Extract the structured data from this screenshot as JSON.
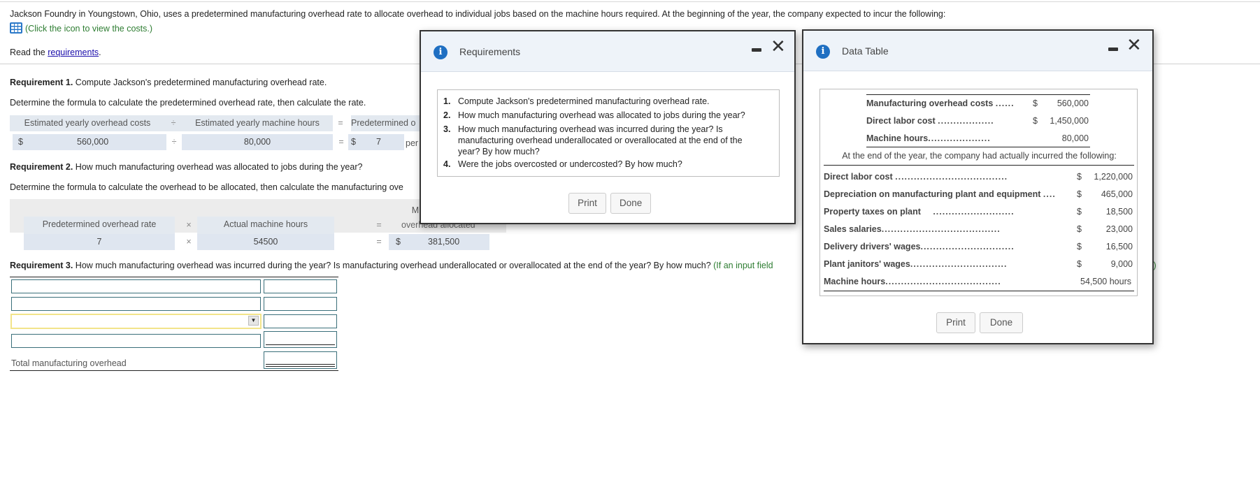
{
  "problem": {
    "intro": "Jackson Foundry in Youngstown, Ohio, uses a predetermined manufacturing overhead rate to allocate overhead to individual jobs based on the machine hours required. At the beginning of the year, the company expected to incur the following:",
    "click_icon_text": "(Click the icon to view the costs.)",
    "read_prefix": "Read the ",
    "requirements_link": "requirements",
    "read_suffix": "."
  },
  "req1": {
    "label": "Requirement 1.",
    "text": " Compute Jackson's predetermined manufacturing overhead rate.",
    "instruction": "Determine the formula to calculate the predetermined overhead rate, then calculate the rate.",
    "headers": [
      "Estimated yearly overhead costs",
      "÷",
      "Estimated yearly machine hours",
      "=",
      "Predetermined o"
    ],
    "values": {
      "currency1": "$",
      "overhead_costs": "560,000",
      "op1": "÷",
      "machine_hours": "80,000",
      "op2": "=",
      "currency2": "$",
      "rate": "7",
      "per": "per"
    }
  },
  "req2": {
    "label": "Requirement 2.",
    "text": " How much manufacturing overhead was allocated to jobs during the year?",
    "instruction": "Determine the formula to calculate the overhead to be allocated, then calculate the manufacturing ove",
    "header_top_partial": "M",
    "headers": [
      "Predetermined overhead rate",
      "×",
      "Actual machine hours",
      "=",
      "overhead allocated"
    ],
    "values": {
      "rate": "7",
      "op1": "×",
      "actual_hours": "54500",
      "op2": "=",
      "currency": "$",
      "allocated": "381,500"
    }
  },
  "req3": {
    "label": "Requirement 3.",
    "text": " How much manufacturing overhead was incurred during the year? Is manufacturing overhead underallocated or overallocated at the end of the year? By how much?",
    "hint": "(If an input field",
    "hint_tail": ".)",
    "rows": [
      {
        "label_value": "",
        "amount_value": ""
      },
      {
        "label_value": "",
        "amount_value": ""
      },
      {
        "label_value": "",
        "amount_value": "",
        "dropdown": true
      },
      {
        "label_value": "",
        "amount_value": ""
      }
    ],
    "total_label": "Total manufacturing overhead",
    "total_value": ""
  },
  "requirements_dialog": {
    "title": "Requirements",
    "items": [
      {
        "num": "1.",
        "text": "Compute Jackson's predetermined manufacturing overhead rate."
      },
      {
        "num": "2.",
        "text": "How much manufacturing overhead was allocated to jobs during the year?"
      },
      {
        "num": "3.",
        "text": "How much manufacturing overhead was incurred during the year? Is manufacturing overhead underallocated or overallocated at the end of the year? By how much?"
      },
      {
        "num": "4.",
        "text": "Were the jobs overcosted or undercosted? By how much?"
      }
    ],
    "print_label": "Print",
    "done_label": "Done"
  },
  "data_dialog": {
    "title": "Data Table",
    "expected": [
      {
        "label": "Manufacturing overhead costs",
        "dots": "......",
        "currency": "$",
        "value": "560,000"
      },
      {
        "label": "Direct labor cost",
        "dots": "..................",
        "currency": "$",
        "value": "1,450,000"
      },
      {
        "label": "Machine hours",
        "dots": "....................",
        "currency": "",
        "value": "80,000"
      }
    ],
    "actual_caption": "At the end of the year, the company had actually incurred the following:",
    "actual": [
      {
        "label": "Direct labor cost",
        "dots": "....................................",
        "currency": "$",
        "value": "1,220,000"
      },
      {
        "label": "Depreciation on manufacturing plant and equipment",
        "dots": "....",
        "currency": "$",
        "value": "465,000"
      },
      {
        "label": "Property taxes on plant",
        "dots": "..........................",
        "currency": "$",
        "value": "18,500"
      },
      {
        "label": "Sales salaries",
        "dots": "......................................",
        "currency": "$",
        "value": "23,000"
      },
      {
        "label": "Delivery drivers' wages",
        "dots": "..............................",
        "currency": "$",
        "value": "16,500"
      },
      {
        "label": "Plant janitors' wages",
        "dots": "...............................",
        "currency": "$",
        "value": "9,000"
      },
      {
        "label": "Machine hours",
        "dots": ".....................................",
        "currency": "",
        "value": "54,500 hours"
      }
    ],
    "print_label": "Print",
    "done_label": "Done"
  },
  "colors": {
    "info_icon": "#1f6fc2",
    "hint_green": "#2e7d32",
    "link_blue": "#1a0dab",
    "input_border": "#3a6f7a",
    "selected_input_border": "#f2e48a",
    "formula_cell_bg": "#dfe6f0"
  }
}
